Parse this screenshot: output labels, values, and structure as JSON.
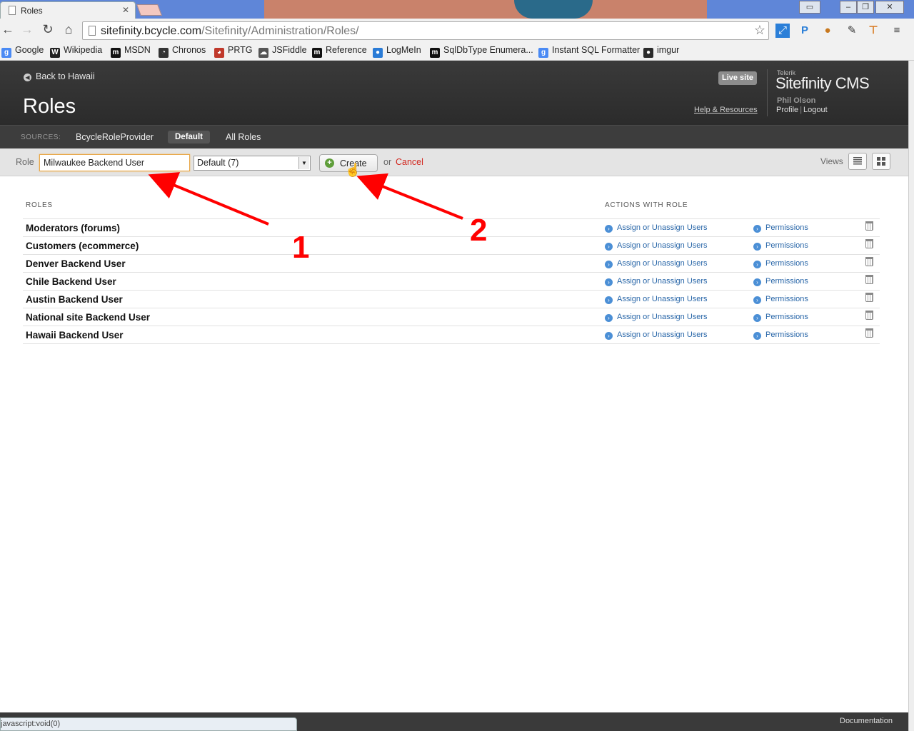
{
  "browser": {
    "tab_title": "Roles",
    "tab_close": "✕",
    "url_host": "sitefinity.bcycle.com",
    "url_path": "/Sitefinity/Administration/Roles/",
    "status_text": "javascript:void(0)",
    "bookmarks": [
      {
        "label": "Google",
        "icon": "google-icon",
        "color": "#4a8af4"
      },
      {
        "label": "Wikipedia",
        "icon": "wikipedia-icon",
        "color": "#222222"
      },
      {
        "label": "MSDN",
        "icon": "msdn-icon",
        "color": "#111111"
      },
      {
        "label": "Chronos",
        "icon": "chronos-icon",
        "color": "#333333"
      },
      {
        "label": "PRTG",
        "icon": "prtg-icon",
        "color": "#c0392b"
      },
      {
        "label": "JSFiddle",
        "icon": "jsfiddle-icon",
        "color": "#555555"
      },
      {
        "label": "Reference",
        "icon": "reference-icon",
        "color": "#111111"
      },
      {
        "label": "LogMeIn",
        "icon": "logmein-icon",
        "color": "#2a7bd6"
      },
      {
        "label": "SqlDbType Enumera...",
        "icon": "sqldbtype-icon",
        "color": "#111111"
      },
      {
        "label": "Instant SQL Formatter",
        "icon": "google-icon",
        "color": "#4a8af4"
      },
      {
        "label": "imgur",
        "icon": "imgur-icon",
        "color": "#2b2b2b"
      }
    ]
  },
  "header": {
    "back_link": "Back to Hawaii",
    "page_title": "Roles",
    "live_site": "Live site",
    "help_link": "Help & Resources",
    "brand_small": "Telerik",
    "brand": "Sitefinity CMS",
    "user_name": "Phil Olson",
    "profile_link": "Profile",
    "logout_link": "Logout"
  },
  "sources": {
    "label": "SOURCES:",
    "items": [
      "BcycleRoleProvider",
      "Default",
      "All Roles"
    ],
    "active": "Default"
  },
  "create_bar": {
    "role_label": "Role",
    "role_value": "Milwaukee Backend User",
    "provider_select": "Default (7)",
    "create_button": "Create",
    "or_text": "or",
    "cancel_link": "Cancel",
    "views_label": "Views"
  },
  "grid": {
    "col_roles": "ROLES",
    "col_actions": "ACTIONS WITH ROLE",
    "assign_label": "Assign or Unassign Users",
    "permissions_label": "Permissions",
    "rows": [
      "Moderators (forums)",
      "Customers (ecommerce)",
      "Denver Backend User",
      "Chile Backend User",
      "Austin Backend User",
      "National site Backend User",
      "Hawaii Backend User"
    ]
  },
  "annotations": {
    "label_1": "1",
    "label_2": "2",
    "color": "#ff0000"
  },
  "footer": {
    "documentation": "Documentation"
  }
}
